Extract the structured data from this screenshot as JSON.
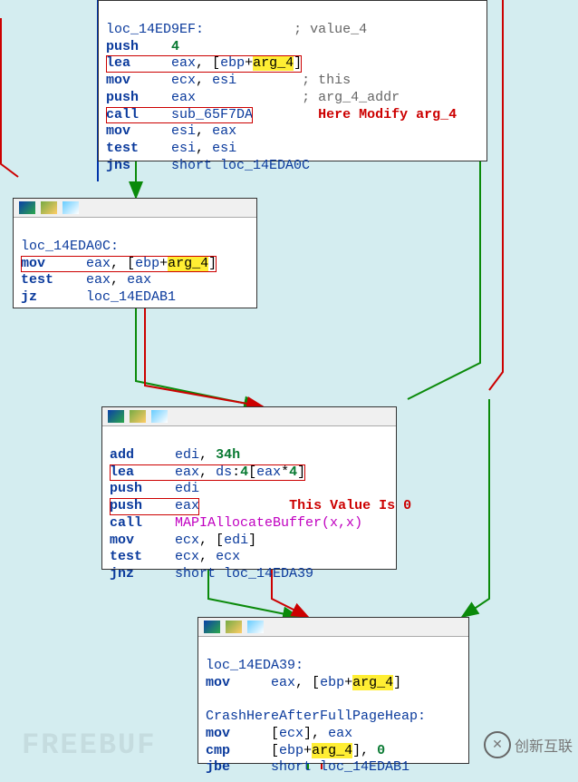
{
  "node1": {
    "lines": [
      {
        "lbl": "loc_14ED9EF:",
        "cmt": "; value_4"
      },
      {
        "mn": "push",
        "ops": "4"
      },
      {
        "mn": "lea",
        "ops": "eax, [ebp+arg_4]",
        "boxed": true,
        "hl": "arg_4"
      },
      {
        "mn": "mov",
        "ops": "ecx, esi",
        "cmt": "; this"
      },
      {
        "mn": "push",
        "ops": "eax",
        "cmt": "; arg_4_addr"
      },
      {
        "mn": "call",
        "ops": "sub_65F7DA",
        "boxed": true,
        "side": "Here Modify arg_4"
      },
      {
        "mn": "mov",
        "ops": "esi, eax"
      },
      {
        "mn": "test",
        "ops": "esi, esi"
      },
      {
        "mn": "jns",
        "ops": "short loc_14EDA0C"
      }
    ]
  },
  "node2": {
    "label": "loc_14EDA0C:",
    "lines": [
      {
        "mn": "mov",
        "ops": "eax, [ebp+arg_4]",
        "boxed": true,
        "hl": "arg_4"
      },
      {
        "mn": "test",
        "ops": "eax, eax"
      },
      {
        "mn": "jz",
        "ops": "loc_14EDAB1"
      }
    ]
  },
  "node3": {
    "lines": [
      {
        "mn": "add",
        "ops": "edi, 34h",
        "num": "34h"
      },
      {
        "mn": "lea",
        "ops": "eax, ds:4[eax*4]",
        "boxed": true,
        "num": "4"
      },
      {
        "mn": "push",
        "ops": "edi"
      },
      {
        "mn": "push",
        "ops": "eax",
        "boxed": true,
        "side": "This Value Is 0"
      },
      {
        "mn": "call",
        "ops": "MAPIAllocateBuffer(x,x)",
        "purple": true
      },
      {
        "mn": "mov",
        "ops": "ecx, [edi]"
      },
      {
        "mn": "test",
        "ops": "ecx, ecx"
      },
      {
        "mn": "jnz",
        "ops": "short loc_14EDA39"
      }
    ]
  },
  "node4": {
    "label": "loc_14EDA39:",
    "lines1": [
      {
        "mn": "mov",
        "ops": "eax, [ebp+arg_4]",
        "hl": "arg_4"
      }
    ],
    "label2": "CrashHereAfterFullPageHeap:",
    "lines2": [
      {
        "mn": "mov",
        "ops": "[ecx], eax"
      },
      {
        "mn": "cmp",
        "ops": "[ebp+arg_4], 0",
        "hl": "arg_4",
        "num": "0"
      },
      {
        "mn": "jbe",
        "ops": "short loc_14EDAB1"
      }
    ]
  },
  "watermarks": {
    "left": "FREEBUF",
    "right": "创新互联"
  }
}
